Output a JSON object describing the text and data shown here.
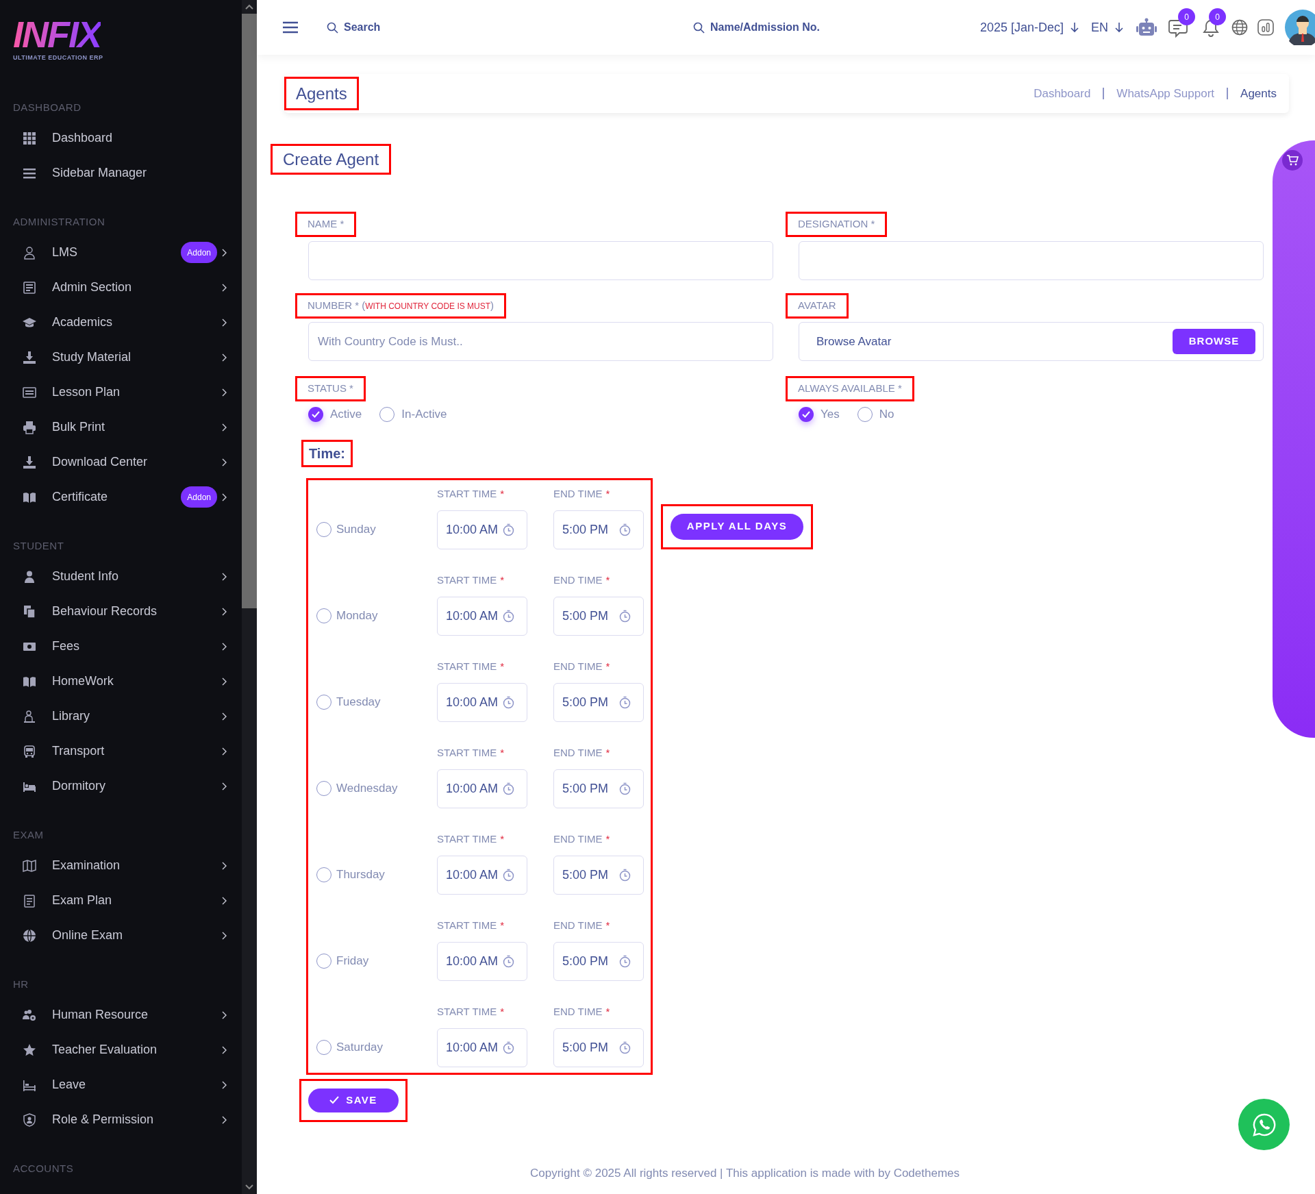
{
  "logo": {
    "wordmark": "INFIX",
    "tagline": "ULTIMATE EDUCATION ERP"
  },
  "sidebar": {
    "sections": [
      {
        "heading": "DASHBOARD",
        "items": [
          {
            "label": "Dashboard",
            "expandable": false
          },
          {
            "label": "Sidebar Manager",
            "expandable": false
          }
        ]
      },
      {
        "heading": "ADMINISTRATION",
        "items": [
          {
            "label": "LMS",
            "badge": "Addon",
            "expandable": true
          },
          {
            "label": "Admin Section",
            "expandable": true
          },
          {
            "label": "Academics",
            "expandable": true
          },
          {
            "label": "Study Material",
            "expandable": true
          },
          {
            "label": "Lesson Plan",
            "expandable": true
          },
          {
            "label": "Bulk Print",
            "expandable": true
          },
          {
            "label": "Download Center",
            "expandable": true
          },
          {
            "label": "Certificate",
            "badge": "Addon",
            "expandable": true
          }
        ]
      },
      {
        "heading": "STUDENT",
        "items": [
          {
            "label": "Student Info",
            "expandable": true
          },
          {
            "label": "Behaviour Records",
            "expandable": true
          },
          {
            "label": "Fees",
            "expandable": true
          },
          {
            "label": "HomeWork",
            "expandable": true
          },
          {
            "label": "Library",
            "expandable": true
          },
          {
            "label": "Transport",
            "expandable": true
          },
          {
            "label": "Dormitory",
            "expandable": true
          }
        ]
      },
      {
        "heading": "EXAM",
        "items": [
          {
            "label": "Examination",
            "expandable": true
          },
          {
            "label": "Exam Plan",
            "expandable": true
          },
          {
            "label": "Online Exam",
            "expandable": true
          }
        ]
      },
      {
        "heading": "HR",
        "items": [
          {
            "label": "Human Resource",
            "expandable": true
          },
          {
            "label": "Teacher Evaluation",
            "expandable": true
          },
          {
            "label": "Leave",
            "expandable": true
          },
          {
            "label": "Role & Permission",
            "expandable": true
          }
        ]
      },
      {
        "heading": "ACCOUNTS"
      }
    ]
  },
  "topbar": {
    "search": {
      "placeholder": "Search"
    },
    "student_search": {
      "placeholder": "Name/Admission No."
    },
    "session": "2025 [Jan-Dec]",
    "language": "EN",
    "messages_count": "0",
    "notifications_count": "0"
  },
  "page_header": {
    "title": "Agents",
    "breadcrumb": [
      {
        "label": "Dashboard",
        "current": false
      },
      {
        "label": "WhatsApp Support",
        "current": false
      },
      {
        "label": "Agents",
        "current": true
      }
    ]
  },
  "form": {
    "title": "Create Agent",
    "name": {
      "label": [
        {
          "text": "NAME *",
          "kind": "plain"
        }
      ]
    },
    "designation": {
      "label": [
        {
          "text": "DESIGNATION *",
          "kind": "plain"
        }
      ]
    },
    "number": {
      "label": [
        {
          "text": "NUMBER * (",
          "kind": "plain"
        },
        {
          "text": "WITH COUNTRY CODE IS MUST",
          "kind": "note"
        },
        {
          "text": ")",
          "kind": "plain"
        }
      ],
      "placeholder": "With Country Code is Must.."
    },
    "avatar": {
      "label": [
        {
          "text": "AVATAR",
          "kind": "plain"
        }
      ],
      "placeholder": "Browse Avatar",
      "button": "BROWSE"
    },
    "status": {
      "label": "STATUS *",
      "options": [
        {
          "label": "Active",
          "selected": true
        },
        {
          "label": "In-Active",
          "selected": false
        }
      ]
    },
    "always_available": {
      "label": "ALWAYS AVAILABLE *",
      "options": [
        {
          "label": "Yes",
          "selected": true
        },
        {
          "label": "No",
          "selected": false
        }
      ]
    },
    "time_title": "Time:",
    "days": [
      {
        "day": "Sunday",
        "selected": false,
        "start_label": "START TIME",
        "start_mark": "*",
        "start": "10:00 AM",
        "end_label": "END TIME",
        "end_mark": "*",
        "end": "5:00 PM"
      },
      {
        "day": "Monday",
        "selected": false,
        "start_label": "START TIME",
        "start_mark": "*",
        "start": "10:00 AM",
        "end_label": "END TIME",
        "end_mark": "*",
        "end": "5:00 PM"
      },
      {
        "day": "Tuesday",
        "selected": false,
        "start_label": "START TIME",
        "start_mark": "*",
        "start": "10:00 AM",
        "end_label": "END TIME",
        "end_mark": "*",
        "end": "5:00 PM"
      },
      {
        "day": "Wednesday",
        "selected": false,
        "start_label": "START TIME",
        "start_mark": "*",
        "start": "10:00 AM",
        "end_label": "END TIME",
        "end_mark": "*",
        "end": "5:00 PM"
      },
      {
        "day": "Thursday",
        "selected": false,
        "start_label": "START TIME",
        "start_mark": "*",
        "start": "10:00 AM",
        "end_label": "END TIME",
        "end_mark": "*",
        "end": "5:00 PM"
      },
      {
        "day": "Friday",
        "selected": false,
        "start_label": "START TIME",
        "start_mark": "*",
        "start": "10:00 AM",
        "end_label": "END TIME",
        "end_mark": "*",
        "end": "5:00 PM"
      },
      {
        "day": "Saturday",
        "selected": false,
        "start_label": "START TIME",
        "start_mark": "*",
        "start": "10:00 AM",
        "end_label": "END TIME",
        "end_mark": "*",
        "end": "5:00 PM"
      }
    ],
    "apply_button": "APPLY ALL DAYS",
    "save_button": "SAVE"
  },
  "footer": "Copyright © 2025 All rights reserved | This application is made with by Codethemes"
}
